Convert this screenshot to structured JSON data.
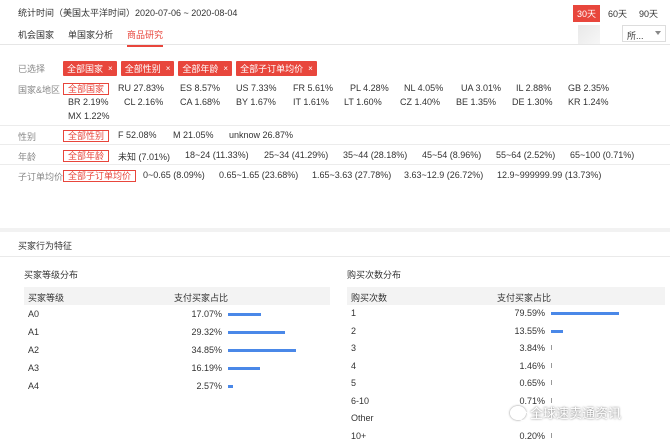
{
  "header": {
    "stat_label": "统计时间（美国太平洋时间）2020-07-06 ~ 2020-08-04",
    "ranges": [
      "30天",
      "60天",
      "90天"
    ]
  },
  "tabs": [
    "机会国家",
    "单国家分析",
    "商品研究"
  ],
  "select": {
    "value": "所..."
  },
  "filters": {
    "selected_label": "已选择",
    "chips": [
      "全部国家",
      "全部性别",
      "全部年龄",
      "全部子订单均价"
    ],
    "country": {
      "label": "国家&地区",
      "chip": "全部国家",
      "row1": [
        "RU 27.83%",
        "ES 8.57%",
        "US 7.33%",
        "FR 5.61%",
        "PL 4.28%",
        "NL 4.05%",
        "UA 3.01%",
        "IL 2.88%",
        "GB 2.35%"
      ],
      "row2": [
        "BR 2.19%",
        "CL 2.16%",
        "CA 1.68%",
        "BY 1.67%",
        "IT 1.61%",
        "LT 1.60%",
        "CZ 1.40%",
        "BE 1.35%",
        "DE 1.30%",
        "KR 1.24%"
      ],
      "row3": [
        "MX 1.22%"
      ]
    },
    "gender": {
      "label": "性别",
      "chip": "全部性别",
      "items": [
        "F 52.08%",
        "M 21.05%",
        "unknow 26.87%"
      ]
    },
    "age": {
      "label": "年龄",
      "chip": "全部年龄",
      "items": [
        "未知 (7.01%)",
        "18~24 (11.33%)",
        "25~34 (41.29%)",
        "35~44 (28.18%)",
        "45~54 (8.96%)",
        "55~64 (2.52%)",
        "65~100 (0.71%)"
      ]
    },
    "price": {
      "label": "子订单均价",
      "chip": "全部子订单均价",
      "items": [
        "0~0.65 (8.09%)",
        "0.65~1.65 (23.68%)",
        "1.65~3.63 (27.78%)",
        "3.63~12.9 (26.72%)",
        "12.9~999999.99 (13.73%)"
      ]
    }
  },
  "buyer_section": {
    "title": "买家行为特征",
    "level": {
      "title": "买家等级分布",
      "col1": "买家等级",
      "col2": "支付买家占比",
      "rows": [
        {
          "name": "A0",
          "value": "17.07%",
          "share": 17.07
        },
        {
          "name": "A1",
          "value": "29.32%",
          "share": 29.32
        },
        {
          "name": "A2",
          "value": "34.85%",
          "share": 34.85
        },
        {
          "name": "A3",
          "value": "16.19%",
          "share": 16.19
        },
        {
          "name": "A4",
          "value": "2.57%",
          "share": 2.57
        }
      ]
    },
    "count": {
      "title": "购买次数分布",
      "col1": "购买次数",
      "col2": "支付买家占比",
      "rows": [
        {
          "name": "1",
          "value": "79.59%",
          "share": 79.59
        },
        {
          "name": "2",
          "value": "13.55%",
          "share": 13.55
        },
        {
          "name": "3",
          "value": "3.84%",
          "share": 3.84
        },
        {
          "name": "4",
          "value": "1.46%",
          "share": 1.46
        },
        {
          "name": "5",
          "value": "0.65%",
          "share": 0.65
        },
        {
          "name": "6-10",
          "value": "0.71%",
          "share": 0.71
        },
        {
          "name": "Other",
          "value": "",
          "share": 0
        },
        {
          "name": "10+",
          "value": "0.20%",
          "share": 0.2
        }
      ]
    }
  },
  "watermark": "全球速卖通资讯",
  "colors": {
    "accent": "#e8463c",
    "bar": "#4a88e8"
  }
}
